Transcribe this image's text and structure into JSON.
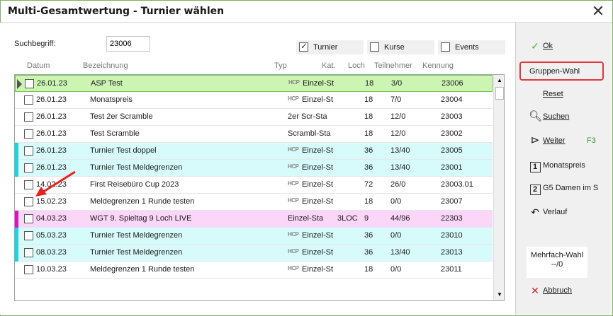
{
  "window": {
    "title": "Multi-Gesamtwertung - Turnier wählen"
  },
  "search": {
    "label": "Suchbegriff:",
    "value": "23006"
  },
  "filters": [
    {
      "label": "Turnier",
      "checked": true
    },
    {
      "label": "Kurse",
      "checked": false
    },
    {
      "label": "Events",
      "checked": false
    }
  ],
  "columns": {
    "datum": "Datum",
    "bezeichnung": "Bezeichnung",
    "typ": "Typ",
    "kat": "Kat.",
    "loch": "Loch",
    "teilnehmer": "Teilnehmer",
    "kennung": "Kennung"
  },
  "rows": [
    {
      "datum": "26.01.23",
      "bezeichnung": "ASP Test",
      "hcp": "HCP",
      "typ": "Einzel-St",
      "loch": "18",
      "teilnehmer": "3/0",
      "kennung": "23006"
    },
    {
      "datum": "26.01.23",
      "bezeichnung": "Monatspreis",
      "hcp": "HCP",
      "typ": "Einzel-St",
      "loch": "18",
      "teilnehmer": "7/0",
      "kennung": "23004"
    },
    {
      "datum": "26.01.23",
      "bezeichnung": "Test 2er Scramble",
      "hcp": "",
      "typ": "2er Scr-Sta",
      "loch": "18",
      "teilnehmer": "12/0",
      "kennung": "23003"
    },
    {
      "datum": "26.01.23",
      "bezeichnung": "Test Scramble",
      "hcp": "",
      "typ": "Scrambl-Sta",
      "loch": "18",
      "teilnehmer": "12/0",
      "kennung": "23002"
    },
    {
      "datum": "26.01.23",
      "bezeichnung": "Turnier Test doppel",
      "hcp": "HCP",
      "typ": "Einzel-St",
      "loch": "36",
      "teilnehmer": "13/40",
      "kennung": "23005"
    },
    {
      "datum": "26.01.23",
      "bezeichnung": "Turnier Test Meldegrenzen",
      "hcp": "HCP",
      "typ": "Einzel-St",
      "loch": "36",
      "teilnehmer": "13/40",
      "kennung": "23001"
    },
    {
      "datum": "14.02.23",
      "bezeichnung": "First Reisebüro Cup 2023",
      "hcp": "HCP",
      "typ": "Einzel-St",
      "loch": "72",
      "teilnehmer": "26/0",
      "kennung": "23003.01"
    },
    {
      "datum": "15.02.23",
      "bezeichnung": "Meldegrenzen 1 Runde testen",
      "hcp": "HCP",
      "typ": "Einzel-St",
      "loch": "18",
      "teilnehmer": "0/0",
      "kennung": "23007"
    },
    {
      "datum": "04.03.23",
      "bezeichnung": "WGT 9. Spieltag 9 Loch LIVE",
      "hcp": "",
      "typ": "Einzel-Sta",
      "kat": "3LOC",
      "loch": "9",
      "teilnehmer": "44/96",
      "kennung": "22303"
    },
    {
      "datum": "05.03.23",
      "bezeichnung": "Turnier Test Meldegrenzen",
      "hcp": "HCP",
      "typ": "Einzel-St",
      "loch": "36",
      "teilnehmer": "0/0",
      "kennung": "23010"
    },
    {
      "datum": "08.03.23",
      "bezeichnung": "Turnier Test Meldegrenzen",
      "hcp": "HCP",
      "typ": "Einzel-St",
      "loch": "36",
      "teilnehmer": "13/40",
      "kennung": "23013"
    },
    {
      "datum": "10.03.23",
      "bezeichnung": "Meldegrenzen 1 Runde testen",
      "hcp": "HCP",
      "typ": "Einzel-St",
      "loch": "18",
      "teilnehmer": "0/0",
      "kennung": "23011"
    }
  ],
  "sidebar": {
    "ok": "Ok",
    "gruppen_wahl": "Gruppen-Wahl",
    "reset": "Reset",
    "suchen": "Suchen",
    "weiter": "Weiter",
    "weiter_key": "F3",
    "monatspreis_num": "1",
    "monatspreis": "Monatspreis",
    "g5_num": "2",
    "g5": "G5 Damen im S",
    "verlauf": "Verlauf",
    "mehrfach_label": "Mehrfach-Wahl",
    "mehrfach_value": "--/0",
    "abbruch": "Abbruch"
  },
  "colors": {
    "selected_row": "#ccf5b4",
    "cyan_row": "#d7fbfb",
    "pink_row": "#fbd6f8",
    "cyan_marker": "#18d6df",
    "magenta_marker": "#e010c8",
    "highlight_border": "#e2383f",
    "ok_check": "#4caf2a",
    "abbruch_x": "#d8252c"
  }
}
